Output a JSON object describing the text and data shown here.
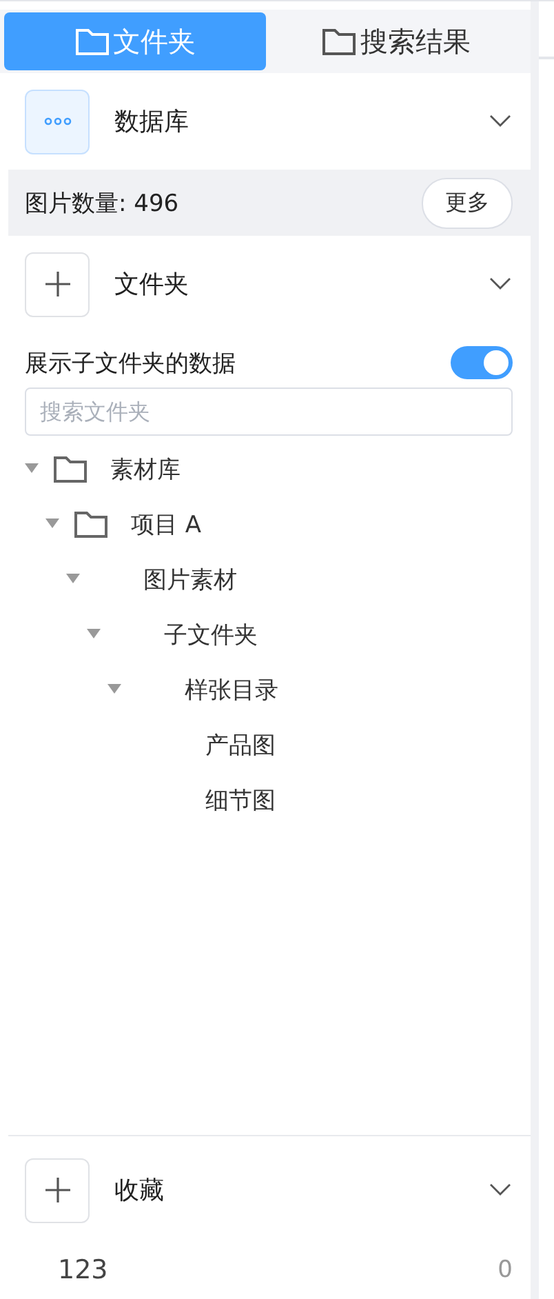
{
  "tabs": [
    {
      "label": "文件夹",
      "selected": true
    },
    {
      "label": "搜索结果",
      "selected": false
    }
  ],
  "database": {
    "title": "数据库",
    "expanded": true
  },
  "image_count": {
    "label": "图片数量: 496",
    "button": "更多"
  },
  "folders": {
    "title": "文件夹",
    "expanded": true,
    "toggle": {
      "label": "展示子文件夹的数据",
      "on": true
    },
    "search": {
      "placeholder": "搜索文件夹"
    },
    "tree": [
      {
        "label": "素材库",
        "expanded": true,
        "children": [
          {
            "label": "项目 A",
            "expanded": true,
            "children": [
              {
                "label": "图片素材",
                "expanded": true,
                "children": [
                  {
                    "label": "子文件夹",
                    "expanded": true,
                    "children": [
                      {
                        "label": "样张目录",
                        "expanded": true,
                        "children": [
                          {
                            "label": "产品图"
                          },
                          {
                            "label": "细节图"
                          }
                        ]
                      }
                    ]
                  }
                ]
              }
            ]
          }
        ]
      }
    ]
  },
  "favorites": {
    "title": "收藏",
    "expanded": true,
    "items": [
      {
        "name": "123",
        "count": "0"
      }
    ]
  }
}
